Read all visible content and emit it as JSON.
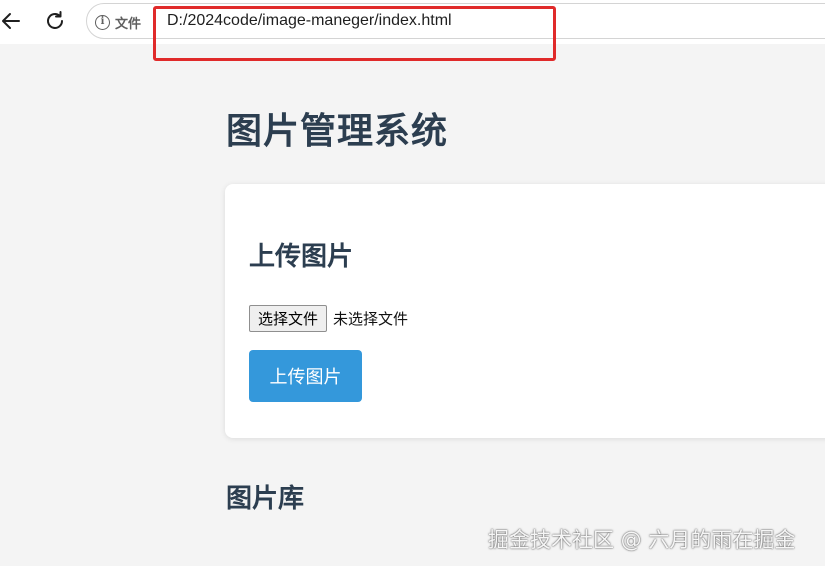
{
  "browser": {
    "site_info_label": "文件",
    "url": "D:/2024code/image-maneger/index.html",
    "annotation_color": "#e02a2a"
  },
  "page": {
    "title": "图片管理系统",
    "upload_section": {
      "heading": "上传图片",
      "choose_file_label": "选择文件",
      "file_status": "未选择文件",
      "upload_button_label": "上传图片",
      "button_color": "#3498db"
    },
    "gallery_heading": "图片库"
  },
  "watermark": "掘金技术社区 @ 六月的雨在掘金"
}
